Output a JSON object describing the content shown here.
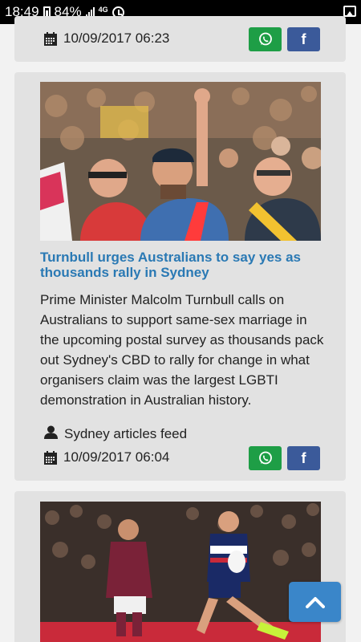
{
  "status_bar": {
    "time": "18:49",
    "battery": "84%",
    "network": "4G"
  },
  "articles": [
    {
      "date": "10/09/2017 06:23"
    },
    {
      "headline": "Turnbull urges Australians to say yes as thousands rally in Sydney",
      "summary": "Prime Minister Malcolm Turnbull calls on Australians to support same-sex marriage in the upcoming postal survey as thousands pack out Sydney's CBD to rally for change in what organisers claim was the largest LGBTI demonstration in Australian history.",
      "source": "Sydney articles feed",
      "date": "10/09/2017 06:04"
    }
  ],
  "share": {
    "facebook_label": "f"
  },
  "colors": {
    "headline": "#2a79b4",
    "whatsapp": "#1e9e46",
    "facebook": "#3b5a9a",
    "scroll_top": "#3a86c9"
  },
  "icons": [
    "calendar-icon",
    "user-icon",
    "whatsapp-icon",
    "chevron-up-icon",
    "gallery-icon",
    "alarm-icon"
  ]
}
